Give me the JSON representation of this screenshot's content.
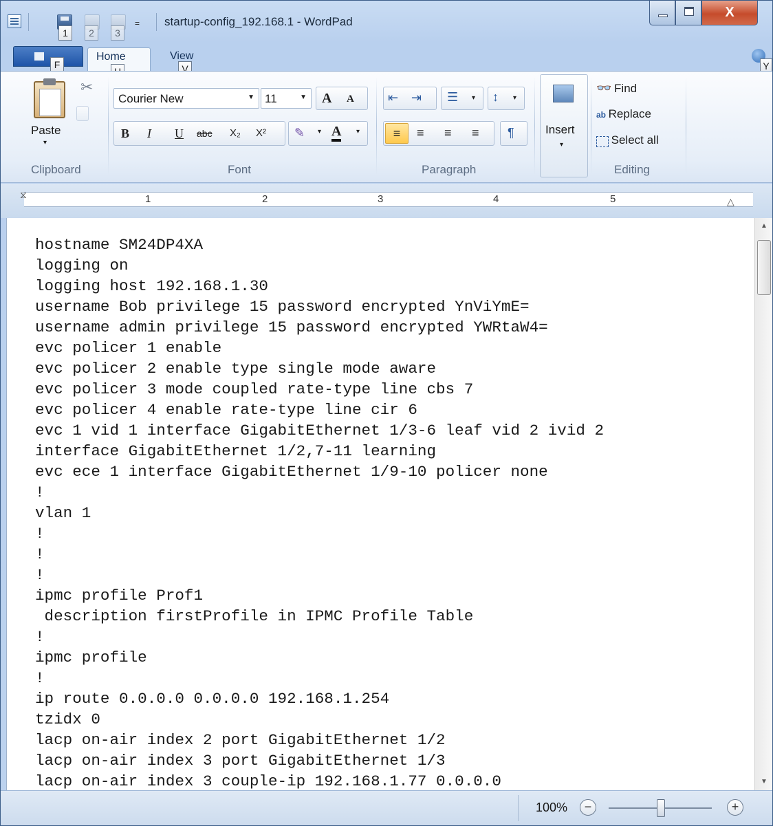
{
  "window": {
    "title": "startup-config_192.168.1 - WordPad",
    "close_glyph": "X"
  },
  "quick_access": {
    "keytips": [
      "1",
      "2",
      "3"
    ],
    "dropdown_glyph": "="
  },
  "ribbon_tabs": {
    "file_keytip": "F",
    "home_label": "Home",
    "home_keytip": "H",
    "view_label": "View",
    "view_keytip": "V",
    "help_keytip": "Y"
  },
  "clipboard": {
    "paste_label": "Paste",
    "group_label": "Clipboard"
  },
  "font": {
    "family": "Courier New",
    "size": "11",
    "group_label": "Font",
    "bold": "B",
    "italic": "I",
    "underline": "U",
    "strike": "abc",
    "subscript": "X₂",
    "superscript": "X²",
    "grow": "A",
    "shrink": "A",
    "color": "A"
  },
  "paragraph": {
    "group_label": "Paragraph"
  },
  "insert": {
    "label": "Insert"
  },
  "editing": {
    "find_label": "Find",
    "replace_label": "Replace",
    "select_all_label": "Select all",
    "group_label": "Editing"
  },
  "ruler": {
    "numbers": [
      "1",
      "2",
      "3",
      "4",
      "5"
    ]
  },
  "document": {
    "lines": [
      "hostname SM24DP4XA",
      "logging on",
      "logging host 192.168.1.30",
      "username Bob privilege 15 password encrypted YnViYmE=",
      "username admin privilege 15 password encrypted YWRtaW4=",
      "evc policer 1 enable",
      "evc policer 2 enable type single mode aware",
      "evc policer 3 mode coupled rate-type line cbs 7",
      "evc policer 4 enable rate-type line cir 6",
      "evc 1 vid 1 interface GigabitEthernet 1/3-6 leaf vid 2 ivid 2",
      "interface GigabitEthernet 1/2,7-11 learning",
      "evc ece 1 interface GigabitEthernet 1/9-10 policer none",
      "!",
      "vlan 1",
      "!",
      "!",
      "!",
      "ipmc profile Prof1",
      " description firstProfile in IPMC Profile Table",
      "!",
      "ipmc profile",
      "!",
      "ip route 0.0.0.0 0.0.0.0 192.168.1.254",
      "tzidx 0",
      "lacp on-air index 2 port GigabitEthernet 1/2",
      "lacp on-air index 3 port GigabitEthernet 1/3",
      "lacp on-air index 3 couple-ip 192.168.1.77 0.0.0.0"
    ]
  },
  "statusbar": {
    "zoom": "100%",
    "zoom_out": "−",
    "zoom_in": "+"
  }
}
